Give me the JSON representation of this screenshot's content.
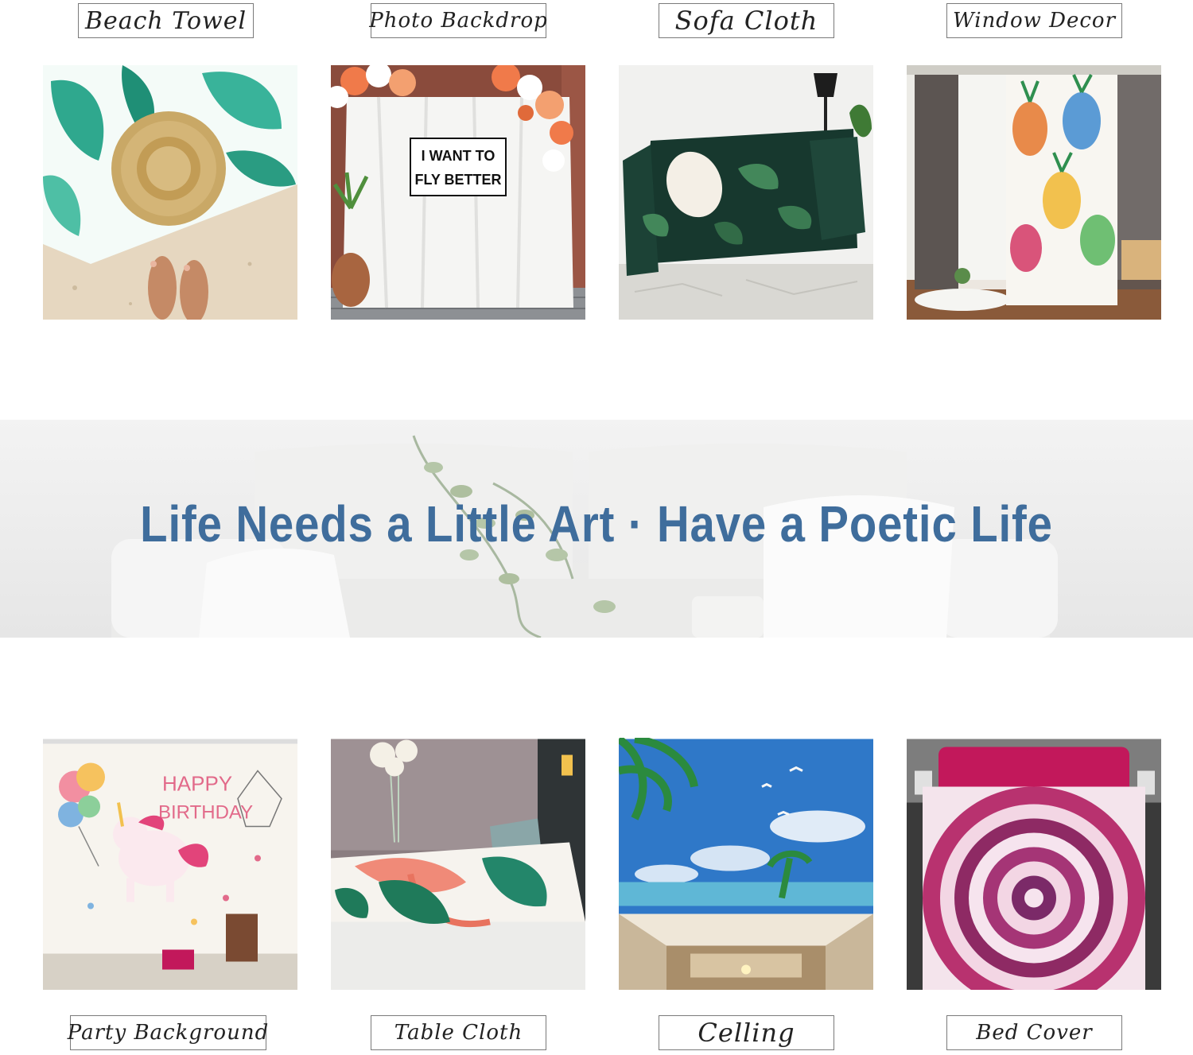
{
  "uses_top": [
    {
      "label": "Beach Towel"
    },
    {
      "label": "Photo Backdrop",
      "sign_line1": "I WANT TO",
      "sign_line2": "FLY BETTER"
    },
    {
      "label": "Sofa Cloth"
    },
    {
      "label": "Window Decor"
    }
  ],
  "banner": {
    "slogan": "Life Needs a Little Art · Have a Poetic Life"
  },
  "uses_bottom": [
    {
      "label": "Party Background",
      "art_line1": "HAPPY",
      "art_line2": "BIRTHDAY"
    },
    {
      "label": "Table Cloth"
    },
    {
      "label": "Celling"
    },
    {
      "label": "Bed Cover"
    }
  ],
  "colors": {
    "slogan": "#3f6d9c",
    "label_border": "#7a7a7a",
    "tropical_green": "#2fa88e",
    "magenta": "#b8326f"
  }
}
